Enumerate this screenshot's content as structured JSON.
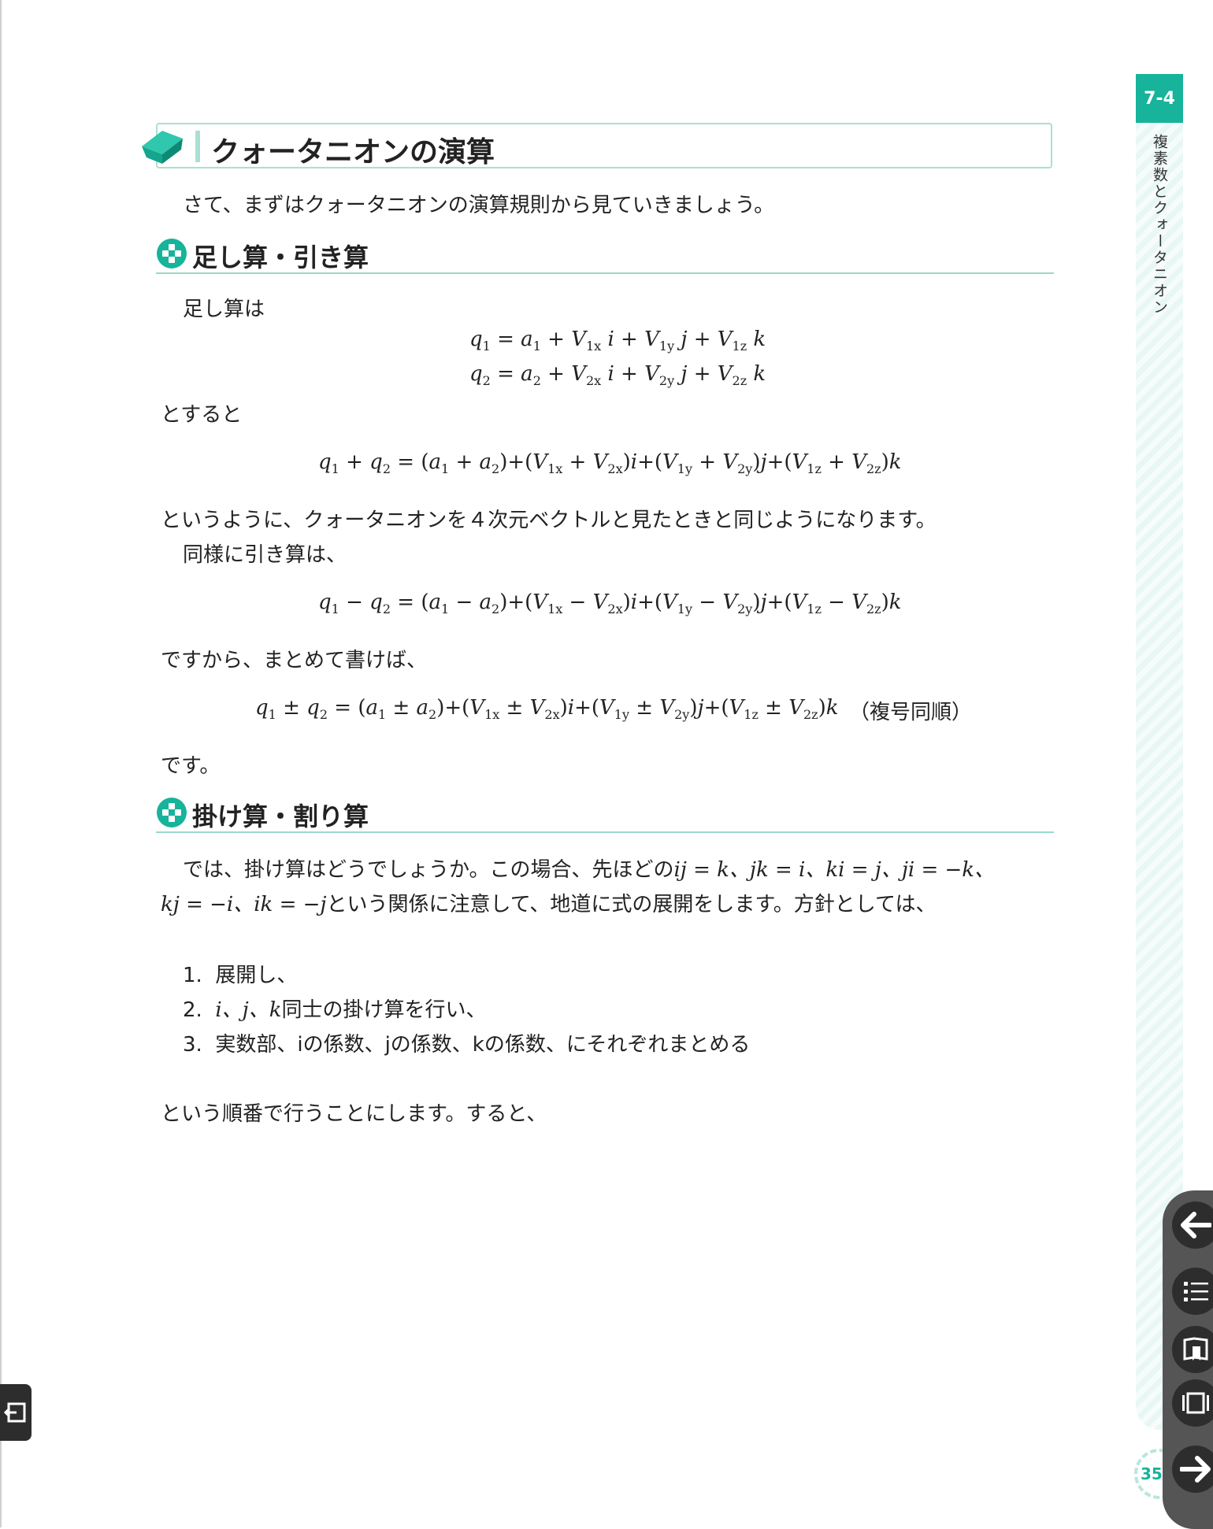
{
  "chapter": {
    "number": "7-4",
    "title": "複素数とクォータニオン",
    "page_number": "351"
  },
  "section": {
    "title": "クォータニオンの演算",
    "intro": "さて、まずはクォータニオンの演算規則から見ていきましょう。"
  },
  "addsub": {
    "heading": "足し算・引き算",
    "p1": "足し算は",
    "eq_q1": "q₁ = a₁ + V₁ₓ i + V₁ᵧ j + V₁𝓏 k",
    "eq_q2": "q₂ = a₂ + V₂ₓ i + V₂ᵧ j + V₂𝓏 k",
    "p2": "とすると",
    "eq_sum": "q₁ + q₂ = (a₁ + a₂)+(V₁ₓ + V₂ₓ)i+(V₁ᵧ + V₂ᵧ)j+(V₁𝓏 + V₂𝓏)k",
    "p3": "というように、クォータニオンを４次元ベクトルと見たときと同じようになります。",
    "p4": "同様に引き算は、",
    "eq_diff": "q₁ − q₂ = (a₁ − a₂)+(V₁ₓ − V₂ₓ)i+(V₁ᵧ − V₂ᵧ)j+(V₁𝓏 − V₂𝓏)k",
    "p5": "ですから、まとめて書けば、",
    "eq_pm": "q₁ ± q₂ = (a₁ ± a₂)+(V₁ₓ ± V₂ₓ)i+(V₁ᵧ ± V₂ᵧ)j+(V₁𝓏 ± V₂𝓏)k",
    "eq_pm_note": "（複号同順）",
    "p6": "です。"
  },
  "muldiv": {
    "heading": "掛け算・割り算",
    "p1_a": "では、掛け算はどうでしょうか。この場合、先ほどの",
    "p1_math": "ij = k、jk = i、ki = j、ji = −k、",
    "p1_b_math": "kj = −i、ik = −j",
    "p1_b": "という関係に注意して、地道に式の展開をします。方針としては、",
    "list": [
      {
        "num": "1.",
        "text": "展開し、"
      },
      {
        "num": "2.",
        "math": "i、j、k",
        "text": "同士の掛け算を行い、"
      },
      {
        "num": "3.",
        "text": "実数部、iの係数、jの係数、kの係数、にそれぞれまとめる"
      }
    ],
    "p2": "という順番で行うことにします。すると、"
  },
  "nav": {
    "icons": [
      "arrow-left-icon",
      "toc-icon",
      "bookmark-icon",
      "page-view-icon",
      "arrow-right-icon",
      "exit-icon"
    ]
  },
  "colors": {
    "accent": "#17b39b",
    "accent_light": "#a8e0d4",
    "strip": "#e9f7f4",
    "nav_bg": "#2d2d2d"
  }
}
